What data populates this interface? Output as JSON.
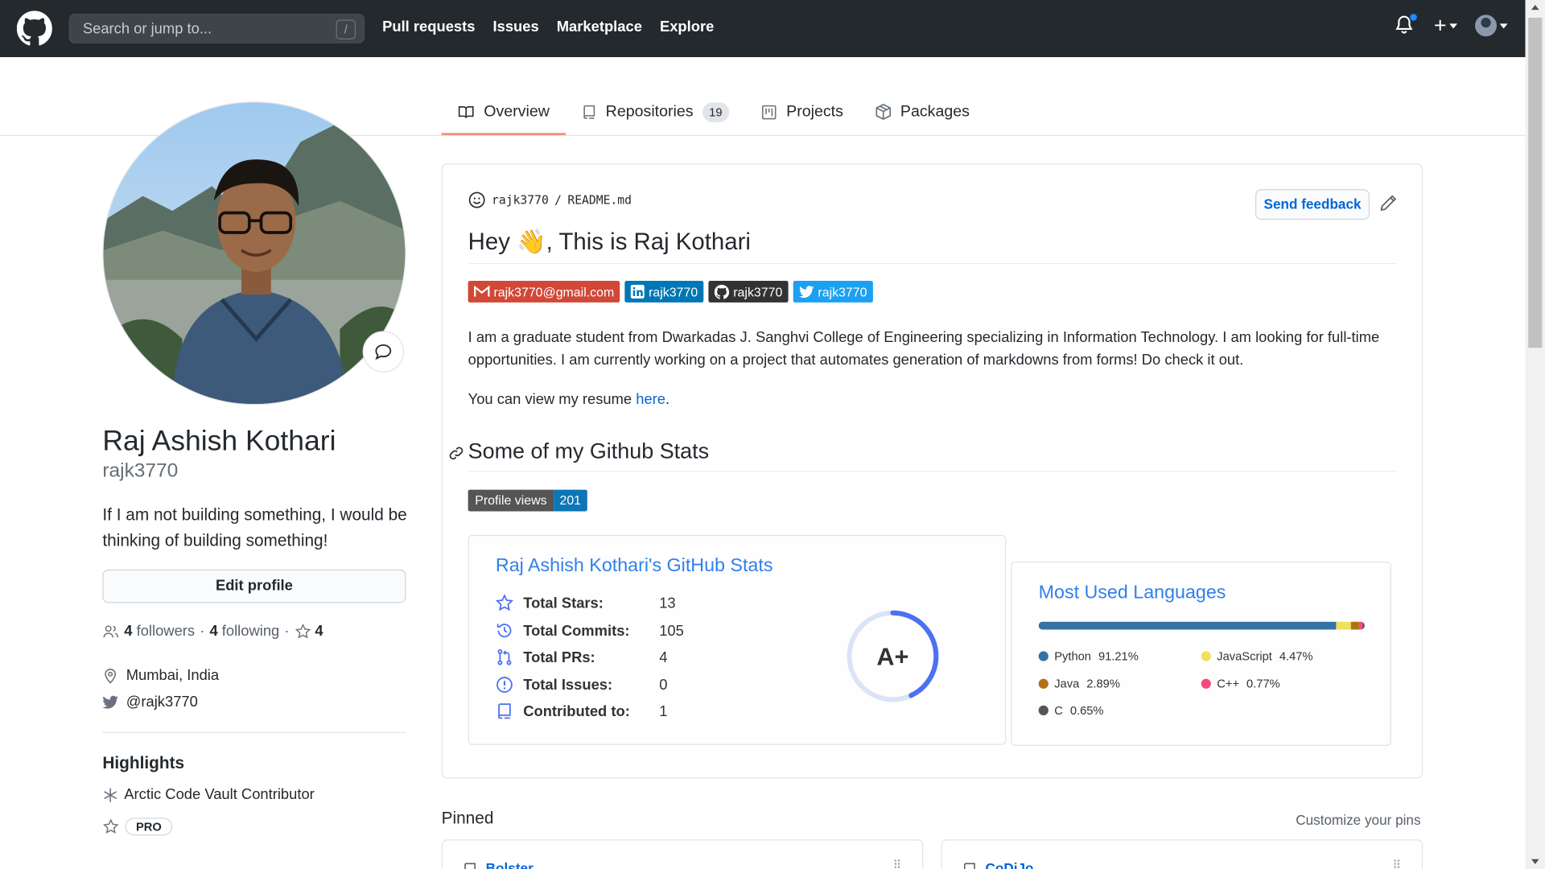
{
  "header": {
    "search_placeholder": "Search or jump to...",
    "search_shortcut": "/",
    "nav": [
      "Pull requests",
      "Issues",
      "Marketplace",
      "Explore"
    ],
    "plus_label": "+"
  },
  "tabs": [
    {
      "label": "Overview",
      "icon": "book-icon",
      "active": true
    },
    {
      "label": "Repositories",
      "icon": "repo-icon",
      "count": "19"
    },
    {
      "label": "Projects",
      "icon": "project-icon"
    },
    {
      "label": "Packages",
      "icon": "package-icon"
    }
  ],
  "profile": {
    "full_name": "Raj Ashish Kothari",
    "login": "rajk3770",
    "bio": "If I am not building something, I would be thinking of building something!",
    "edit_label": "Edit profile",
    "followers_count": "4",
    "followers_label": "followers",
    "following_count": "4",
    "following_label": "following",
    "stars_count": "4",
    "location": "Mumbai, India",
    "twitter": "@rajk3770",
    "highlights_title": "Highlights",
    "highlight_1": "Arctic Code Vault Contributor",
    "highlight_pro": "PRO"
  },
  "readme": {
    "path_user": "rajk3770",
    "path_sep": "/",
    "path_file": "README.md",
    "feedback_label": "Send feedback",
    "heading_pre": "Hey",
    "heading_emoji": "👋",
    "heading_post": ", This is Raj Kothari",
    "badges": [
      {
        "text": "rajk3770@gmail.com",
        "color": "#d14836"
      },
      {
        "text": "rajk3770",
        "color": "#0077b5"
      },
      {
        "text": "rajk3770",
        "color": "#333333"
      },
      {
        "text": "rajk3770",
        "color": "#1ca0f2"
      }
    ],
    "intro": "I am a graduate student from Dwarkadas J. Sanghvi College of Engineering specializing in Information Technology. I am looking for full-time opportunities. I am currently working on a project that automates generation of markdowns from forms! Do check it out.",
    "resume_pre": "You can view my resume ",
    "resume_link": "here",
    "resume_post": ".",
    "stats_heading": "Some of my Github Stats",
    "profile_views_label": "Profile views",
    "profile_views_value": "201"
  },
  "stats_card": {
    "title": "Raj Ashish Kothari's GitHub Stats",
    "rows": [
      {
        "label": "Total Stars:",
        "value": "13",
        "icon": "star-icon"
      },
      {
        "label": "Total Commits:",
        "value": "105",
        "icon": "history-icon"
      },
      {
        "label": "Total PRs:",
        "value": "4",
        "icon": "pull-request-icon"
      },
      {
        "label": "Total Issues:",
        "value": "0",
        "icon": "issue-icon"
      },
      {
        "label": "Contributed to:",
        "value": "1",
        "icon": "repo-icon"
      }
    ],
    "grade": "A+",
    "grade_progress": 0.43
  },
  "lang_card": {
    "title": "Most Used Languages",
    "languages": [
      {
        "name": "Python",
        "percent": "91.21%",
        "value": 91.21,
        "color": "#3572A5"
      },
      {
        "name": "JavaScript",
        "percent": "4.47%",
        "value": 4.47,
        "color": "#f1e05a"
      },
      {
        "name": "Java",
        "percent": "2.89%",
        "value": 2.89,
        "color": "#b07219"
      },
      {
        "name": "C++",
        "percent": "0.77%",
        "value": 0.77,
        "color": "#f34b7d"
      },
      {
        "name": "C",
        "percent": "0.65%",
        "value": 0.65,
        "color": "#555555"
      }
    ]
  },
  "pinned": {
    "title": "Pinned",
    "customize_label": "Customize your pins",
    "repos": [
      "Bolster",
      "CoDiJo"
    ]
  },
  "colors": {
    "header_bg": "#24292e",
    "link": "#0366d6",
    "tab_active": "#f9826c",
    "card_title": "#2f80ed"
  }
}
